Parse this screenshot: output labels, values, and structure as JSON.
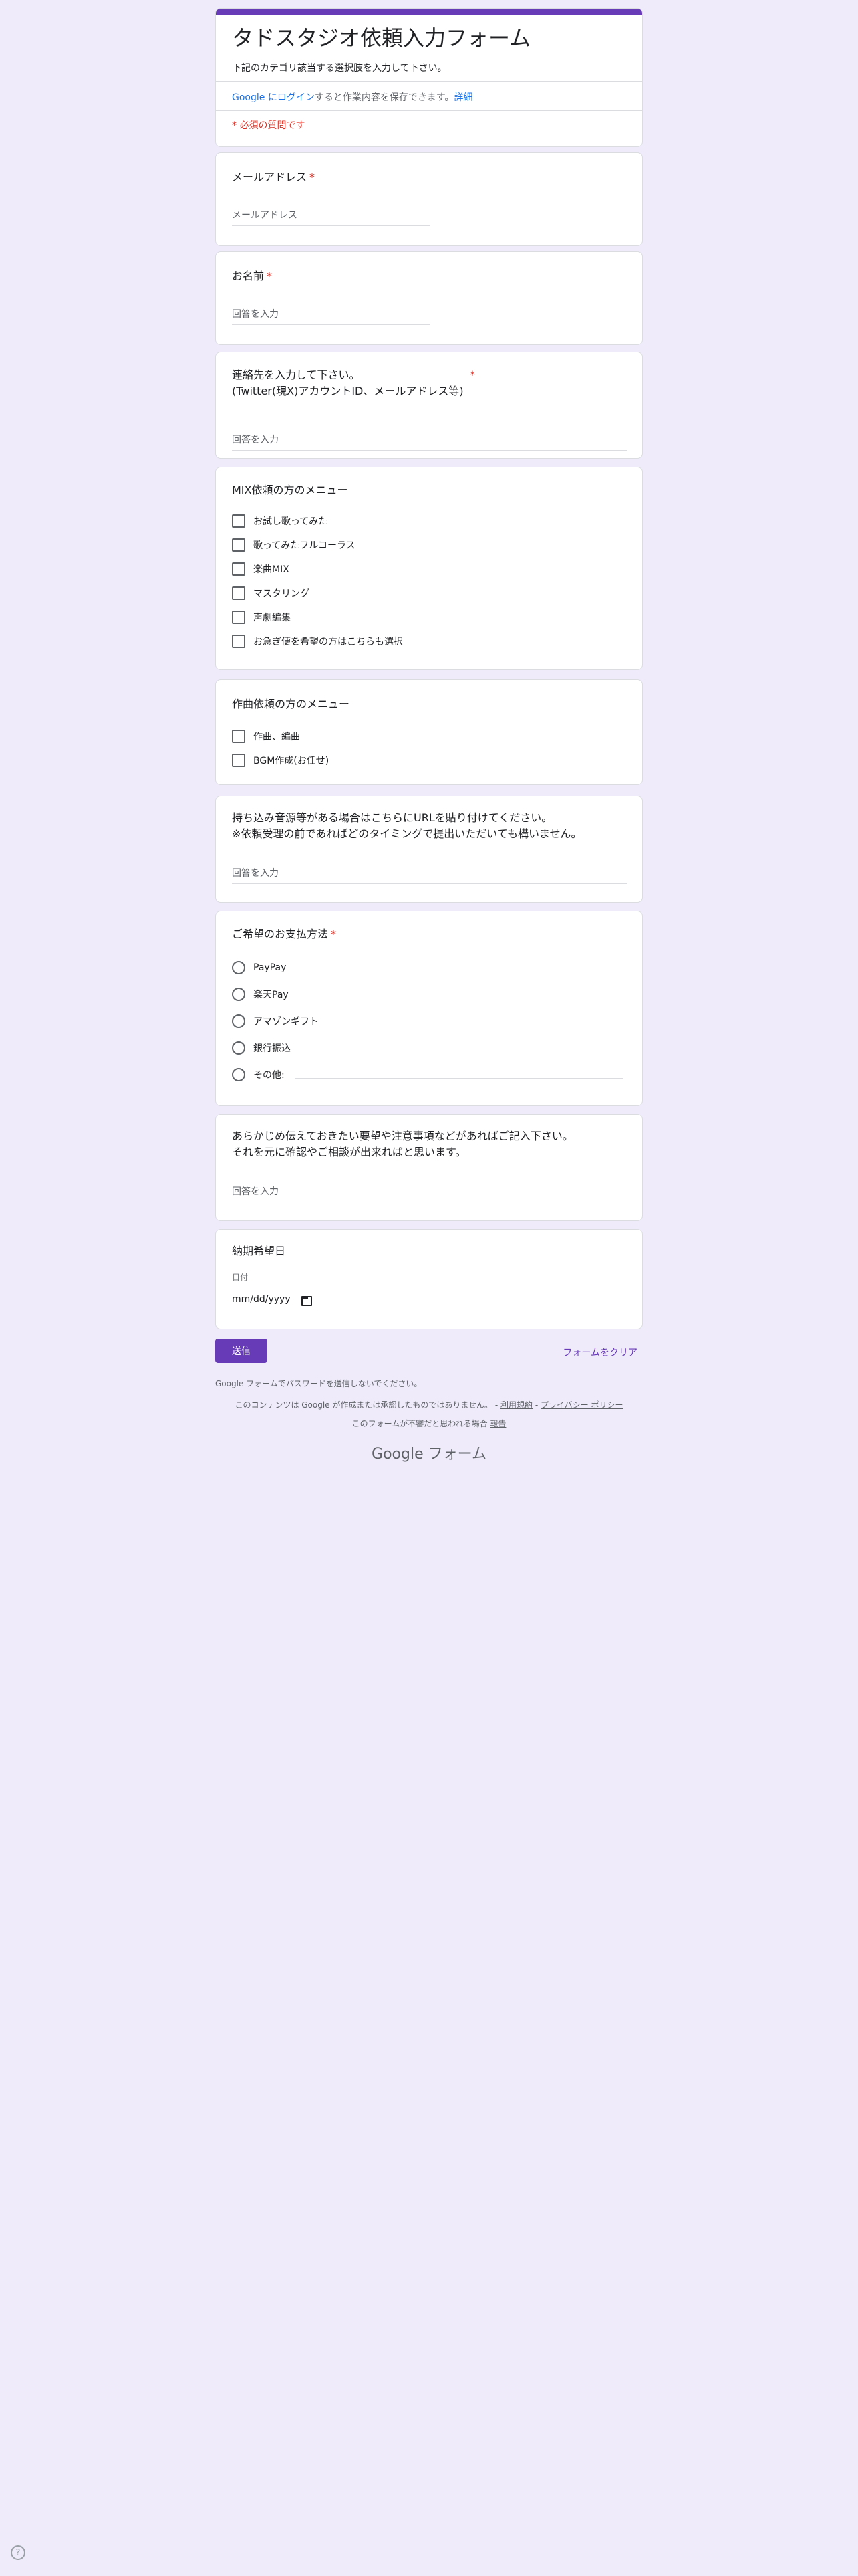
{
  "header": {
    "title": "タドスタジオ依頼入力フォーム",
    "description": "下記のカテゴリ該当する選択肢を入力して下さい。",
    "login_link": "Google にログイン",
    "login_text": "すると作業内容を保存できます。",
    "details_link": "詳細",
    "required_note": "* 必須の質問です"
  },
  "questions": {
    "email": {
      "title": "メールアドレス",
      "required": "*",
      "placeholder": "メールアドレス"
    },
    "name": {
      "title": "お名前",
      "required": "*",
      "placeholder": "回答を入力"
    },
    "contact": {
      "title_line1": "連絡先を入力して下さい。",
      "title_line2": "(Twitter(現X)アカウントID、メールアドレス等)",
      "required": "*",
      "placeholder": "回答を入力"
    },
    "mix_menu": {
      "title": "MIX依頼の方のメニュー",
      "options": [
        "お試し歌ってみた",
        "歌ってみたフルコーラス",
        "楽曲MIX",
        "マスタリング",
        "声劇編集",
        "お急ぎ便を希望の方はこちらも選択"
      ]
    },
    "compose_menu": {
      "title": "作曲依頼の方のメニュー",
      "options": [
        "作曲、編曲",
        "BGM作成(お任せ)"
      ]
    },
    "source": {
      "title_line1": "持ち込み音源等がある場合はこちらにURLを貼り付けてください。",
      "title_line2": "※依頼受理の前であればどのタイミングで提出いただいても構いません。",
      "placeholder": "回答を入力"
    },
    "payment": {
      "title": "ご希望のお支払方法",
      "required": "*",
      "options": [
        "PayPay",
        "楽天Pay",
        "アマゾンギフト",
        "銀行振込",
        "その他:"
      ]
    },
    "notes": {
      "title_line1": "あらかじめ伝えておきたい要望や注意事項などがあればご記入下さい。",
      "title_line2": "それを元に確認やご相談が出来ればと思います。",
      "placeholder": "回答を入力"
    },
    "due_date": {
      "title": "納期希望日",
      "hint": "日付",
      "value": "mm/dd/yyyy"
    }
  },
  "actions": {
    "submit": "送信",
    "clear": "フォームをクリア"
  },
  "footer": {
    "password_warning": "Google フォームでパスワードを送信しないでください。",
    "disclaimer": "このコンテンツは Google が作成または承認したものではありません。 - ",
    "terms": "利用規約",
    "sep": " - ",
    "privacy": "プライバシー ポリシー",
    "abuse_text": "このフォームが不審だと思われる場合 ",
    "report": "報告",
    "brand_google": "Google",
    "brand_forms": " フォーム"
  },
  "help": {
    "label": "?"
  }
}
